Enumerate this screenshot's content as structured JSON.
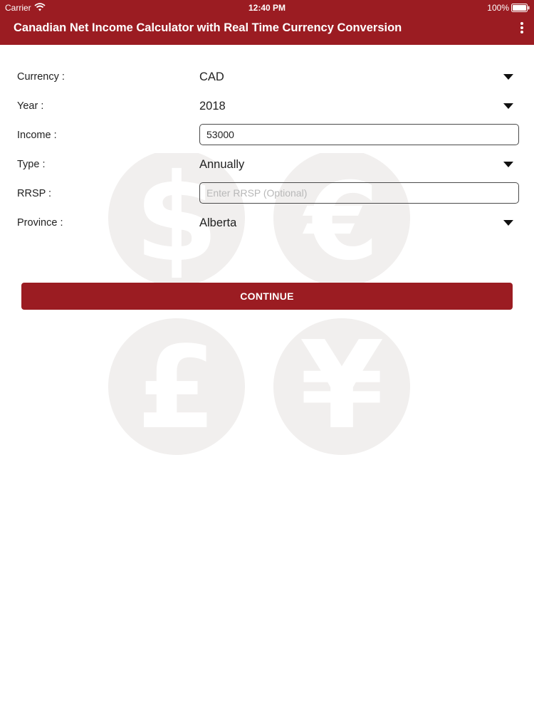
{
  "status_bar": {
    "carrier": "Carrier",
    "time": "12:40 PM",
    "battery": "100%"
  },
  "header": {
    "title": "Canadian Net Income Calculator with Real Time Currency Conversion",
    "menu_icon": "more-vertical-icon"
  },
  "form": {
    "currency": {
      "label": "Currency :",
      "value": "CAD"
    },
    "year": {
      "label": "Year :",
      "value": "2018"
    },
    "income": {
      "label": "Income :",
      "value": "53000"
    },
    "type": {
      "label": "Type :",
      "value": "Annually"
    },
    "rrsp": {
      "label": "RRSP :",
      "placeholder": "Enter RRSP (Optional)"
    },
    "province": {
      "label": "Province :",
      "value": "Alberta"
    }
  },
  "continue_label": "CONTINUE",
  "colors": {
    "brand": "#9b1c22",
    "watermark": "#f1efee"
  },
  "watermark_symbols": [
    "$",
    "€",
    "£",
    "¥"
  ]
}
